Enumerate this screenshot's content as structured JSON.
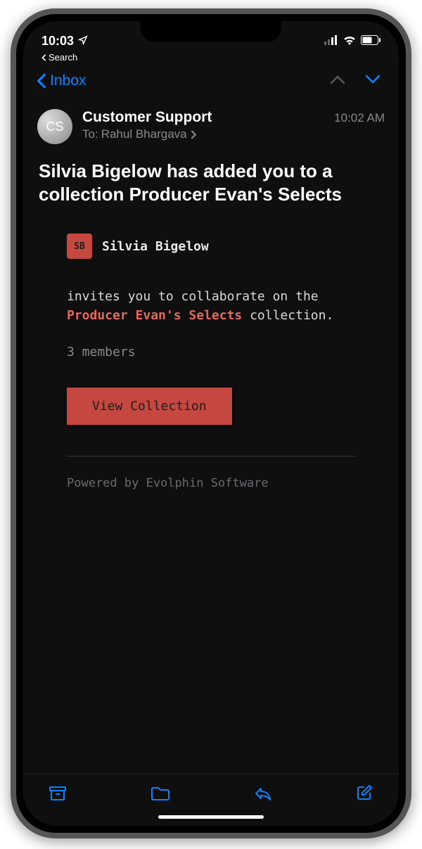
{
  "status": {
    "time": "10:03",
    "back_app": "Search"
  },
  "nav": {
    "back_label": "Inbox"
  },
  "email": {
    "avatar_initials": "CS",
    "sender": "Customer Support",
    "time": "10:02 AM",
    "to_prefix": "To:",
    "recipient": "Rahul Bhargava",
    "subject": "Silvia Bigelow has added you to a collection Producer Evan's Selects"
  },
  "body": {
    "inviter_initials": "SB",
    "inviter_name": "Silvia Bigelow",
    "text_before": "invites you to collaborate on the",
    "collection_name": "Producer Evan's Selects",
    "text_after": "collection.",
    "members": "3 members",
    "cta": "View Collection",
    "powered": "Powered by Evolphin Software"
  }
}
